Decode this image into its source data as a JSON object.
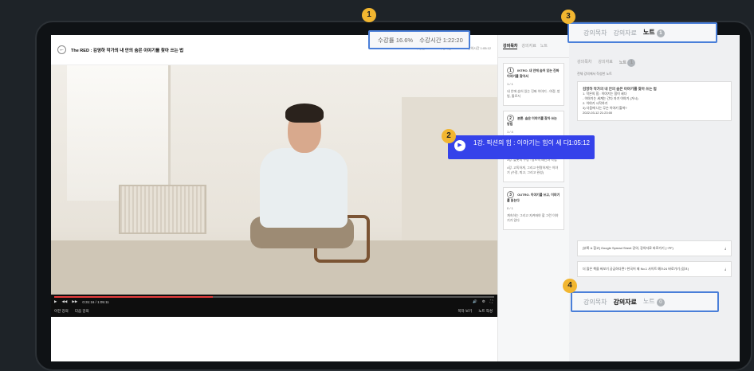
{
  "video": {
    "title": "The RED : 김영하 작가의 내 안의 숨은 이야기를 찾아 쓰는 법",
    "stats": [
      "수강률 16.6%",
      "수강시간 1:22:20",
      "강의시간 1:05:12"
    ],
    "time": "0:31:16 / 1:05:11",
    "controls": [
      "이전 강의",
      "다음 강의",
      "목차 보기",
      "노트 작성"
    ]
  },
  "panel": {
    "tabs": [
      "강의목차",
      "강의자료",
      "노트"
    ],
    "sections": [
      {
        "num": "1",
        "title": "INTRO. 내 안에 숨어 있는 진짜 이야기를 찾아서",
        "count": "1 / 1",
        "items": [
          "내 안에 숨어 있는 진짜 이야기 - 여정, 방법, 툴로서"
        ]
      },
      {
        "num": "2",
        "title": "본론. 숨은 이야기를 찾아 쓰는 방법",
        "count": "1 / 4",
        "items": [
          "1강. 작가의 서약",
          "2강. 서사의 설계",
          "3강. 플롯의 구성 : 장르적 패턴과 작법",
          "4강. 고독하게, 그리고 현명하게는 이야기 (수정, 퇴고, 그리고 완성)"
        ]
      },
      {
        "num": "3",
        "title": "OUTRO. 이야기를 쓰고, 이야기를 읽는다",
        "count": "0 / 1",
        "items": [
          "계속하는 그리고 지켜봐야 할 그런 이야기가 있다"
        ]
      }
    ]
  },
  "notes": {
    "tabs": [
      "강의목차",
      "강의자료",
      "노트"
    ],
    "count": "1",
    "header": "전체 강의에서 작성한 노트",
    "card": {
      "title": "김영하 작가의 내 안의 숨은 이야기를 찾아 쓰는 법",
      "lines": [
        "1. 작은의 힘 : 이야기는 힘이 세다",
        "- 이야기는 세계는 간다 자기 이야기 (거시)",
        "2. 이야기 시작하기",
        "3) 다음에 나는 무슨 이야기 할까?",
        "2022-03-12 21:23:00"
      ]
    },
    "materials": [
      "[부록 & 참고] Google Spread Sheet 강의, 강의자료 바로가기 (~PF)",
      "더 많은 책을 써보기 궁금하다면? 한국어 제 No.1 사이트 예스24 바로가기 (링크)"
    ]
  },
  "callouts": {
    "c1": {
      "badge": "1",
      "a": "수강률 16.6%",
      "b": "수강시간 1:22:20"
    },
    "c2": {
      "badge": "2",
      "text": "1강. 픽션의 힘 : 이야기는 힘이 세 다",
      "time": "1:05:12"
    },
    "c3": {
      "badge": "3",
      "tabs": [
        "강의목차",
        "강의자료",
        "노트"
      ],
      "count": "1"
    },
    "c4": {
      "badge": "4",
      "tabs": [
        "강의목차",
        "강의자료",
        "노트"
      ],
      "count": "0"
    }
  }
}
